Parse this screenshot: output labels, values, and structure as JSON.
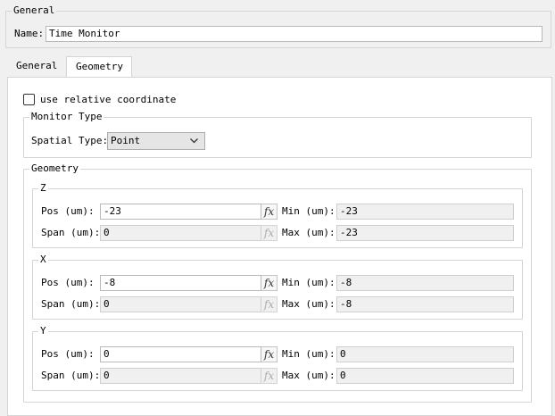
{
  "general_group": {
    "legend": "General",
    "name_label": "Name:",
    "name_value": "Time Monitor"
  },
  "tabs": [
    {
      "label": "General",
      "active": false
    },
    {
      "label": "Geometry",
      "active": true
    }
  ],
  "geometry_tab": {
    "relative_checkbox": {
      "label": "use relative coordinate",
      "checked": false
    },
    "monitor_type": {
      "legend": "Monitor Type",
      "spatial_label": "Spatial Type:",
      "spatial_value": "Point"
    },
    "geometry_group": {
      "legend": "Geometry",
      "axes": [
        {
          "legend": "Z",
          "pos_label": "Pos (um):",
          "pos": "-23",
          "span_label": "Span (um):",
          "span": "0",
          "min_label": "Min (um):",
          "min": "-23",
          "max_label": "Max (um):",
          "max": "-23"
        },
        {
          "legend": "X",
          "pos_label": "Pos (um):",
          "pos": "-8",
          "span_label": "Span (um):",
          "span": "0",
          "min_label": "Min (um):",
          "min": "-8",
          "max_label": "Max (um):",
          "max": "-8"
        },
        {
          "legend": "Y",
          "pos_label": "Pos (um):",
          "pos": "0",
          "span_label": "Span (um):",
          "span": "0",
          "min_label": "Min (um):",
          "min": "0",
          "max_label": "Max (um):",
          "max": "0"
        }
      ],
      "fx_symbol": "fx"
    }
  }
}
